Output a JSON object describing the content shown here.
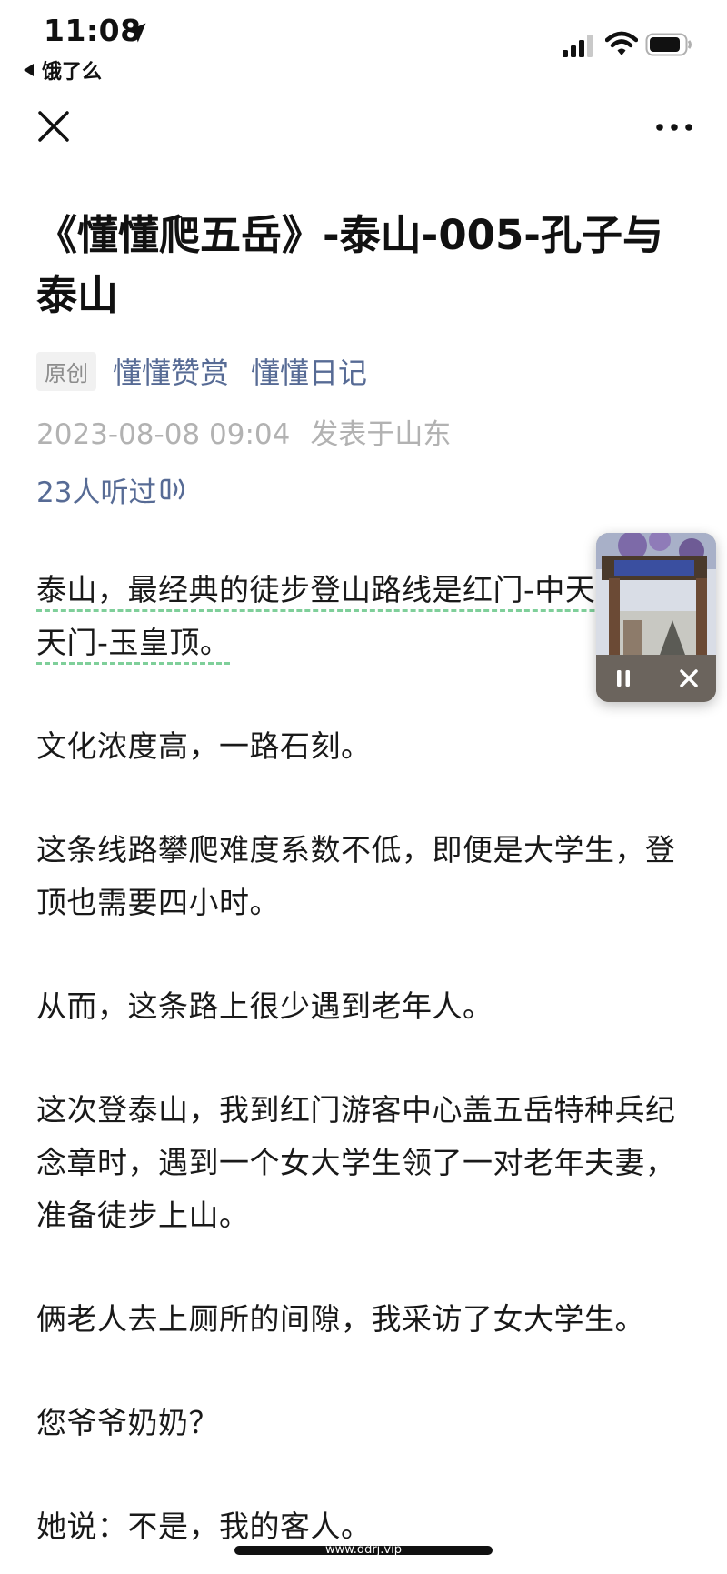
{
  "status_bar": {
    "time": "11:08",
    "back_app": "饿了么",
    "icons": [
      "location-arrow-icon",
      "signal-icon",
      "wifi-icon",
      "battery-icon"
    ]
  },
  "nav": {
    "icons": [
      "close-icon",
      "more-icon"
    ]
  },
  "article": {
    "title": "《懂懂爬五岳》-泰山-005-孔子与泰山",
    "badge": "原创",
    "author": "懂懂赞赏",
    "account": "懂懂日记",
    "date": "2023-08-08 09:04",
    "location": "发表于山东",
    "listen": "23人听过",
    "paragraphs": [
      "泰山，最经典的徒步登山路线是红门-中天门-南天门-玉皇顶。",
      "文化浓度高，一路石刻。",
      "这条线路攀爬难度系数不低，即便是大学生，登顶也需要四小时。",
      "从而，这条路上很少遇到老年人。",
      "这次登泰山，我到红门游客中心盖五岳特种兵纪念章时，遇到一个女大学生领了一对老年夫妻，准备徒步上山。",
      "俩老人去上厕所的间隙，我采访了女大学生。",
      "您爷爷奶奶？",
      "她说：不是，我的客人。"
    ]
  },
  "mini_player": {
    "state": "playing",
    "icons": [
      "pause-icon",
      "close-icon"
    ]
  },
  "watermark": "www.ddrj.vip",
  "colors": {
    "link": "#576b95",
    "meta_gray": "#b2b2b2",
    "underline": "#7fcf9a"
  }
}
